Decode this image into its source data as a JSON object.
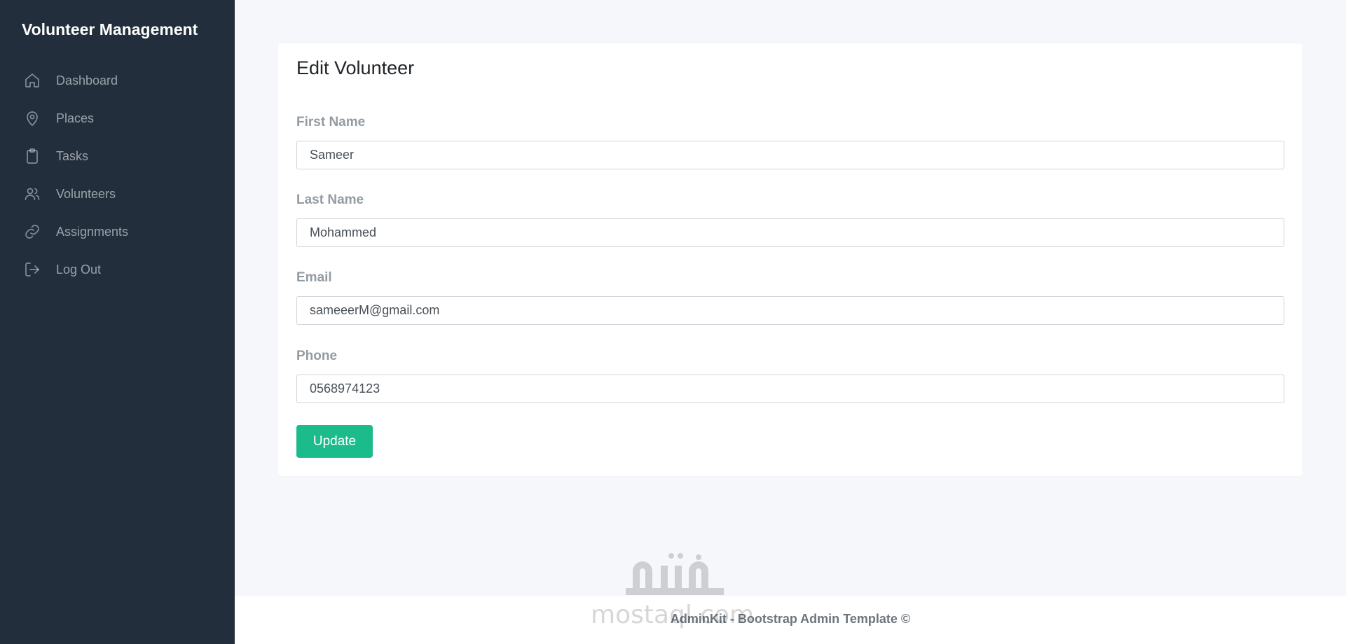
{
  "sidebar": {
    "brand": "Volunteer Management",
    "items": [
      {
        "label": "Dashboard",
        "icon": "home-icon"
      },
      {
        "label": "Places",
        "icon": "map-pin-icon"
      },
      {
        "label": "Tasks",
        "icon": "clipboard-icon"
      },
      {
        "label": "Volunteers",
        "icon": "users-icon"
      },
      {
        "label": "Assignments",
        "icon": "link-icon"
      },
      {
        "label": "Log Out",
        "icon": "log-out-icon"
      }
    ]
  },
  "form": {
    "title": "Edit Volunteer",
    "first_name": {
      "label": "First Name",
      "value": "Sameer"
    },
    "last_name": {
      "label": "Last Name",
      "value": "Mohammed"
    },
    "email": {
      "label": "Email",
      "value": "sameeerM@gmail.com"
    },
    "phone": {
      "label": "Phone",
      "value": "0568974123"
    },
    "submit_label": "Update"
  },
  "footer": {
    "text": "AdminKit - Bootstrap Admin Template ©"
  },
  "watermark": {
    "text": "mostaql.com"
  },
  "colors": {
    "sidebar_bg": "#222e3c",
    "page_bg": "#f5f7fb",
    "accent": "#1cbb8c"
  }
}
